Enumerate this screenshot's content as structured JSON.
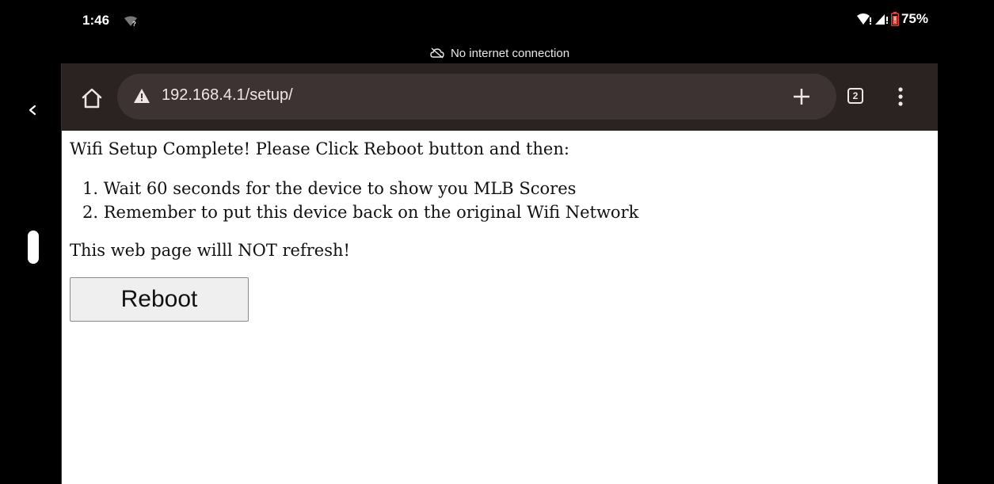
{
  "status_bar": {
    "time": "1:46",
    "battery": "75%",
    "offline_banner": "No internet connection"
  },
  "toolbar": {
    "url": "192.168.4.1/setup/",
    "tab_count": "2"
  },
  "page": {
    "heading": "Wifi Setup Complete! Please Click Reboot button and then:",
    "steps": [
      "1. Wait 60 seconds for the device to show you MLB Scores",
      "2. Remember to put this device back on the original Wifi Network"
    ],
    "note": "This web page willl NOT refresh!",
    "reboot_label": "Reboot"
  },
  "colors": {
    "toolbar_bg": "#2b2222",
    "url_bar_bg": "#3e3333",
    "battery_warning": "#e8453c"
  }
}
